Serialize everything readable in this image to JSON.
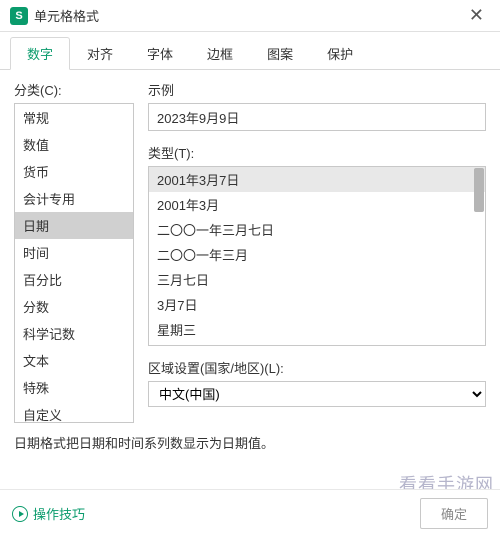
{
  "window": {
    "app_icon_letter": "S",
    "title": "单元格格式"
  },
  "tabs": [
    {
      "label": "数字",
      "active": true
    },
    {
      "label": "对齐",
      "active": false
    },
    {
      "label": "字体",
      "active": false
    },
    {
      "label": "边框",
      "active": false
    },
    {
      "label": "图案",
      "active": false
    },
    {
      "label": "保护",
      "active": false
    }
  ],
  "category": {
    "label": "分类(C):",
    "items": [
      "常规",
      "数值",
      "货币",
      "会计专用",
      "日期",
      "时间",
      "百分比",
      "分数",
      "科学记数",
      "文本",
      "特殊",
      "自定义"
    ],
    "selected_index": 4
  },
  "sample": {
    "label": "示例",
    "value": "2023年9月9日"
  },
  "type": {
    "label": "类型(T):",
    "items": [
      "2001年3月7日",
      "2001年3月",
      "二〇〇一年三月七日",
      "二〇〇一年三月",
      "三月七日",
      "3月7日",
      "星期三"
    ],
    "selected_index": 0
  },
  "locale": {
    "label": "区域设置(国家/地区)(L):",
    "value": "中文(中国)"
  },
  "description": "日期格式把日期和时间系列数显示为日期值。",
  "footer": {
    "tips_label": "操作技巧",
    "ok_label": "确定"
  },
  "watermark": "看看手游网"
}
